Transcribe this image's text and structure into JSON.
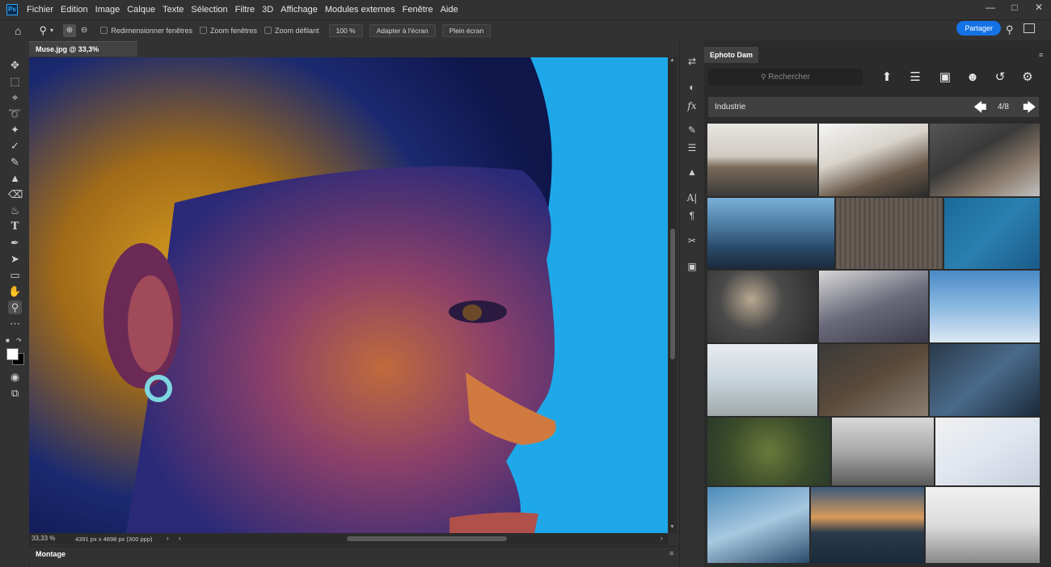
{
  "menu": {
    "app_icon": "Ps",
    "items": [
      "Fichier",
      "Edition",
      "Image",
      "Calque",
      "Texte",
      "Sélection",
      "Filtre",
      "3D",
      "Affichage",
      "Modules externes",
      "Fenêtre",
      "Aide"
    ]
  },
  "window_controls": [
    "minimize-icon",
    "maximize-icon",
    "close-icon"
  ],
  "options": {
    "resize_windows": "Redimensionner fenêtres",
    "zoom_all": "Zoom fenêtres",
    "scrubby_zoom": "Zoom défilant",
    "zoom_value": "100 %",
    "fit_screen": "Adapter à l'écran",
    "full_screen": "Plein écran",
    "share": "Partager"
  },
  "document": {
    "tab_title": "Muse.jpg @ 33,3% (RVB/8)",
    "zoom_status": "33,33 %",
    "doc_info": "4391 px x 4898 px (300 ppp)"
  },
  "bottom_panel": {
    "label": "Montage"
  },
  "plugin_panel": {
    "tab": "Ephoto Dam",
    "search_placeholder": "Rechercher",
    "category": "Industrie",
    "page": "4/8"
  },
  "colors": {
    "accent": "#1473e6",
    "canvas_bg": "#1ea8e9"
  }
}
